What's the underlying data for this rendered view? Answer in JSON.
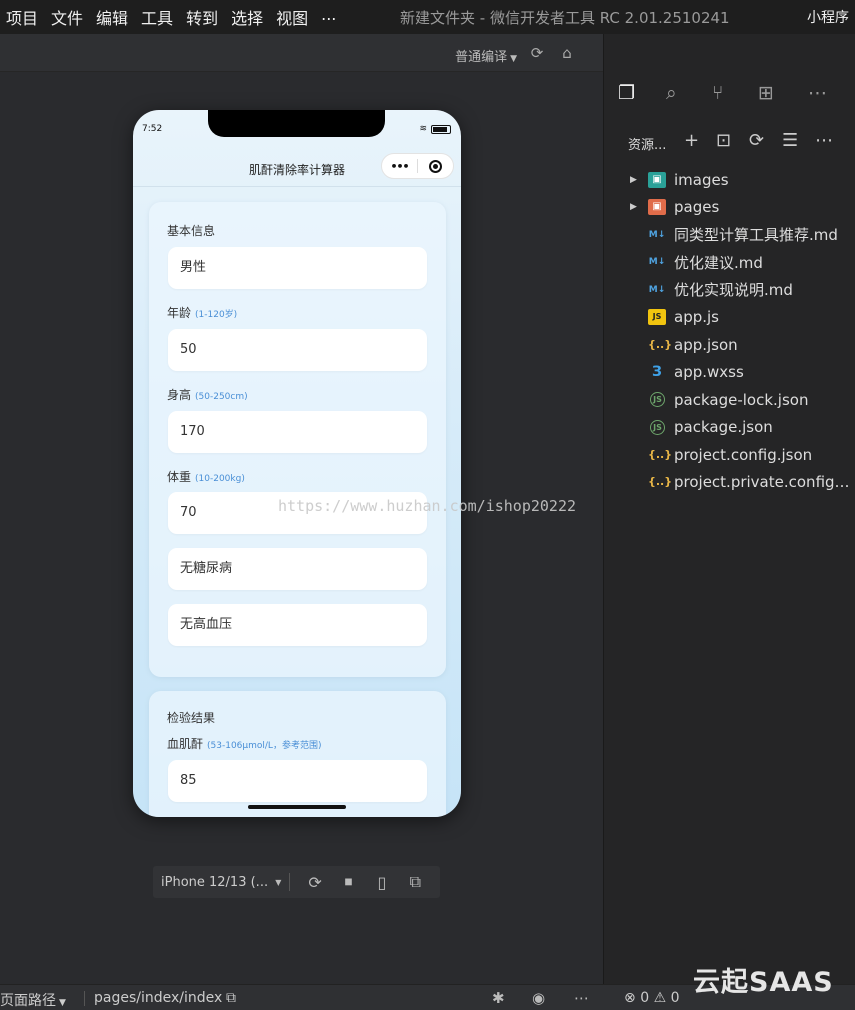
{
  "menubar": {
    "items": [
      "项目",
      "文件",
      "编辑",
      "工具",
      "转到",
      "选择",
      "视图",
      "..."
    ],
    "window_title": "新建文件夹 - 微信开发者工具 RC 2.01.2510241",
    "right_label": "小程序"
  },
  "simbar": {
    "compile_mode": "普通编译"
  },
  "phone": {
    "time": "7:52",
    "nav_title": "肌酐清除率计算器",
    "capsule_dots": "•••",
    "section1": {
      "title": "基本信息",
      "gender": "男性",
      "age_label": "年龄",
      "age_hint": "(1-120岁)",
      "age_value": "50",
      "height_label": "身高",
      "height_hint": "(50-250cm)",
      "height_value": "170",
      "weight_label": "体重",
      "weight_hint": "(10-200kg)",
      "weight_value": "70",
      "diabetes": "无糖尿病",
      "hypertension": "无高血压"
    },
    "section2": {
      "title": "检验结果",
      "scr_label": "血肌酐",
      "scr_hint": "(53-106μmol/L，参考范围)",
      "scr_value": "85"
    }
  },
  "watermark": "https://www.huzhan.com/ishop20222",
  "device_bar": {
    "device": "iPhone 12/13 (..."
  },
  "statusbar": {
    "path_label": "页面路径",
    "path": "pages/index/index",
    "errors": "0",
    "warnings": "0"
  },
  "explorer": {
    "title": "资源...",
    "files": [
      {
        "name": "images",
        "type": "folder",
        "icon": "folder-images-icon"
      },
      {
        "name": "pages",
        "type": "folder",
        "icon": "folder-pages-icon"
      },
      {
        "name": "同类型计算工具推荐.md",
        "type": "md",
        "icon": "markdown-icon"
      },
      {
        "name": "优化建议.md",
        "type": "md",
        "icon": "markdown-icon"
      },
      {
        "name": "优化实现说明.md",
        "type": "md",
        "icon": "markdown-icon"
      },
      {
        "name": "app.js",
        "type": "js",
        "icon": "javascript-icon"
      },
      {
        "name": "app.json",
        "type": "json",
        "icon": "json-icon"
      },
      {
        "name": "app.wxss",
        "type": "css",
        "icon": "css-icon"
      },
      {
        "name": "package-lock.json",
        "type": "pkg",
        "icon": "nodejs-icon"
      },
      {
        "name": "package.json",
        "type": "pkg",
        "icon": "nodejs-icon"
      },
      {
        "name": "project.config.json",
        "type": "json",
        "icon": "json-icon"
      },
      {
        "name": "project.private.config.js...",
        "type": "json",
        "icon": "json-icon"
      }
    ]
  },
  "brand": "云起SAAS"
}
